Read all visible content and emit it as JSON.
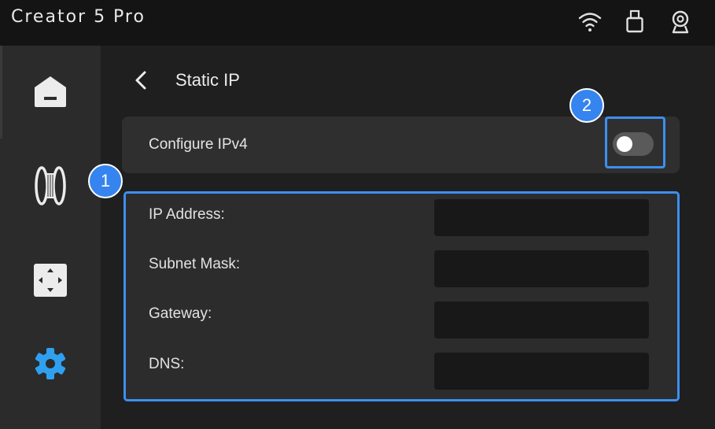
{
  "app": {
    "title": "Creator 5 Pro"
  },
  "status_icons": [
    "wifi-icon",
    "usb-icon",
    "camera-icon"
  ],
  "sidebar": {
    "items": [
      {
        "icon": "home-icon",
        "active": false
      },
      {
        "icon": "filament-spool-icon",
        "active": false
      },
      {
        "icon": "move-control-icon",
        "active": false
      },
      {
        "icon": "settings-gear-icon",
        "active": true
      }
    ]
  },
  "page": {
    "title": "Static IP"
  },
  "configure_ipv4": {
    "label": "Configure IPv4",
    "enabled": false
  },
  "fields": [
    {
      "label": "IP Address:",
      "value": ""
    },
    {
      "label": "Subnet Mask:",
      "value": ""
    },
    {
      "label": "Gateway:",
      "value": ""
    },
    {
      "label": "DNS:",
      "value": ""
    }
  ],
  "callouts": [
    "1",
    "2"
  ],
  "colors": {
    "accent": "#3d8fef",
    "background": "#1f1f1f",
    "topbar": "#141414",
    "sidebar": "#2b2b2b",
    "panel": "#2c2c2c",
    "input": "#181818",
    "active_icon": "#2fa0f0"
  }
}
